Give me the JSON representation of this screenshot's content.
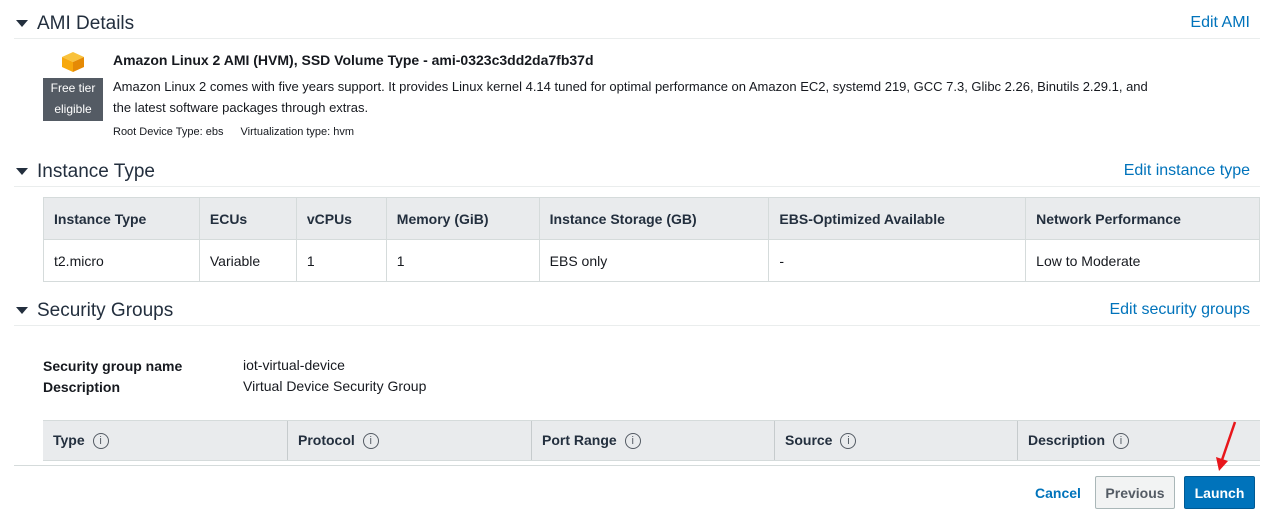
{
  "ami": {
    "title": "AMI Details",
    "edit_label": "Edit AMI",
    "badge_line1": "Free tier",
    "badge_line2": "eligible",
    "name": "Amazon Linux 2 AMI (HVM), SSD Volume Type - ami-0323c3dd2da7fb37d",
    "description": "Amazon Linux 2 comes with five years support. It provides Linux kernel 4.14 tuned for optimal performance on Amazon EC2, systemd 219, GCC 7.3, Glibc 2.26, Binutils 2.29.1, and the latest software packages through extras.",
    "root_device": "Root Device Type: ebs",
    "virtualization": "Virtualization type: hvm",
    "icon": "package-cube-icon",
    "icon_color": "#f7a80d"
  },
  "instance_type": {
    "title": "Instance Type",
    "edit_label": "Edit instance type",
    "columns": [
      "Instance Type",
      "ECUs",
      "vCPUs",
      "Memory (GiB)",
      "Instance Storage (GB)",
      "EBS-Optimized Available",
      "Network Performance"
    ],
    "rows": [
      [
        "t2.micro",
        "Variable",
        "1",
        "1",
        "EBS only",
        "-",
        "Low to Moderate"
      ]
    ]
  },
  "security_groups": {
    "title": "Security Groups",
    "edit_label": "Edit security groups",
    "name_label": "Security group name",
    "name_value": "iot-virtual-device",
    "description_label": "Description",
    "description_value": "Virtual Device Security Group",
    "rule_columns": [
      "Type",
      "Protocol",
      "Port Range",
      "Source",
      "Description"
    ],
    "info_glyph": "i"
  },
  "footer": {
    "cancel_label": "Cancel",
    "previous_label": "Previous",
    "launch_label": "Launch"
  },
  "colors": {
    "link": "#0073bb",
    "primary_button": "#0073bb",
    "badge": "#545b64",
    "annotation_arrow": "#e8161b"
  }
}
